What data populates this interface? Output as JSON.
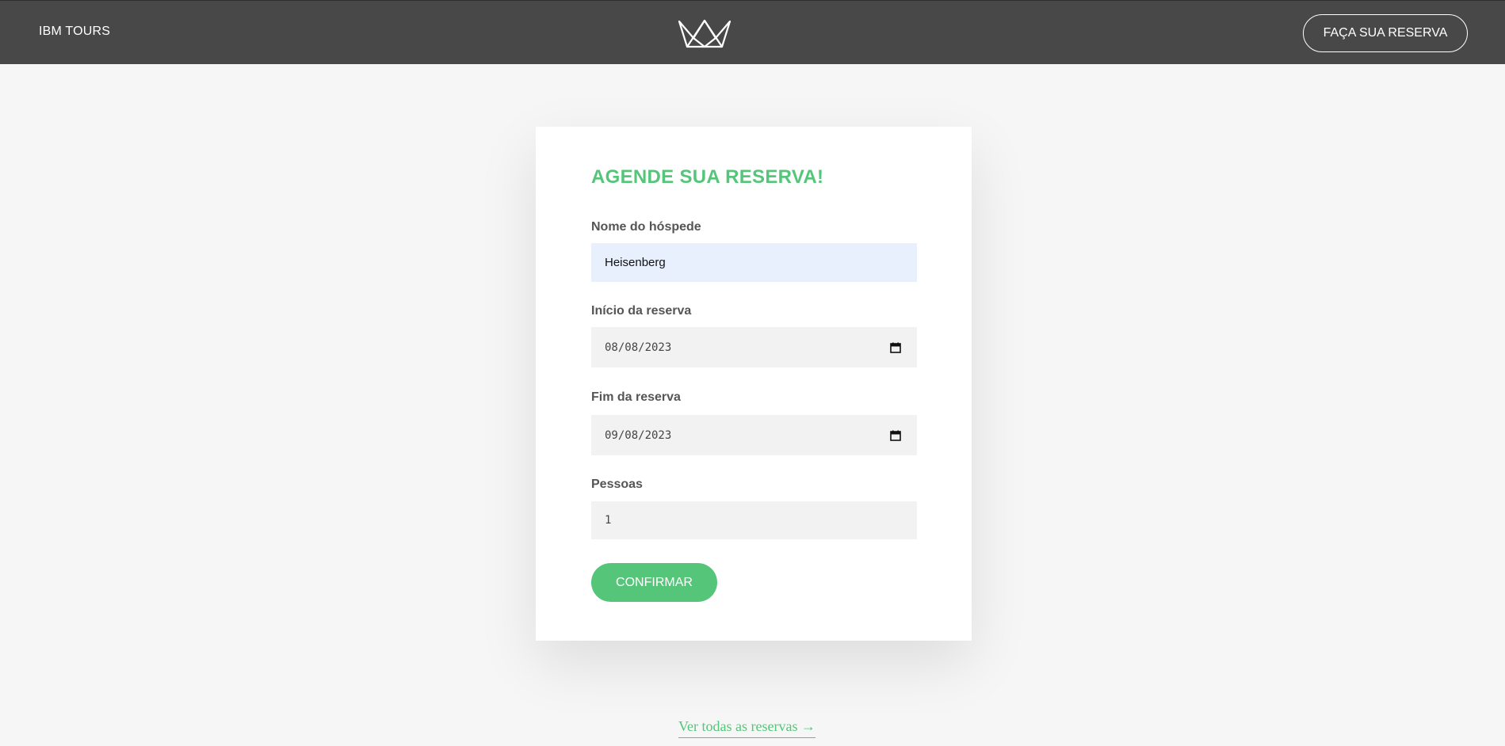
{
  "header": {
    "brand": "IBM TOURS",
    "logo_icon": "crown-icon",
    "cta_label": "FAÇA SUA RESERVA"
  },
  "form": {
    "title": "AGENDE SUA RESERVA!",
    "guest": {
      "label": "Nome do hóspede",
      "value": "Heisenberg"
    },
    "start": {
      "label": "Início da reserva",
      "value": "08/08/2023",
      "icon": "calendar-icon"
    },
    "end": {
      "label": "Fim da reserva",
      "value": "09/08/2023",
      "icon": "calendar-icon"
    },
    "people": {
      "label": "Pessoas",
      "value": "1"
    },
    "submit_label": "CONFIRMAR"
  },
  "footer": {
    "link_label": "Ver todas as reservas →"
  },
  "colors": {
    "header_bg": "#484848",
    "page_bg": "#f6f6f6",
    "accent": "#55c57a",
    "autofill_bg": "#e8f0fe",
    "input_bg": "#f2f2f2"
  }
}
